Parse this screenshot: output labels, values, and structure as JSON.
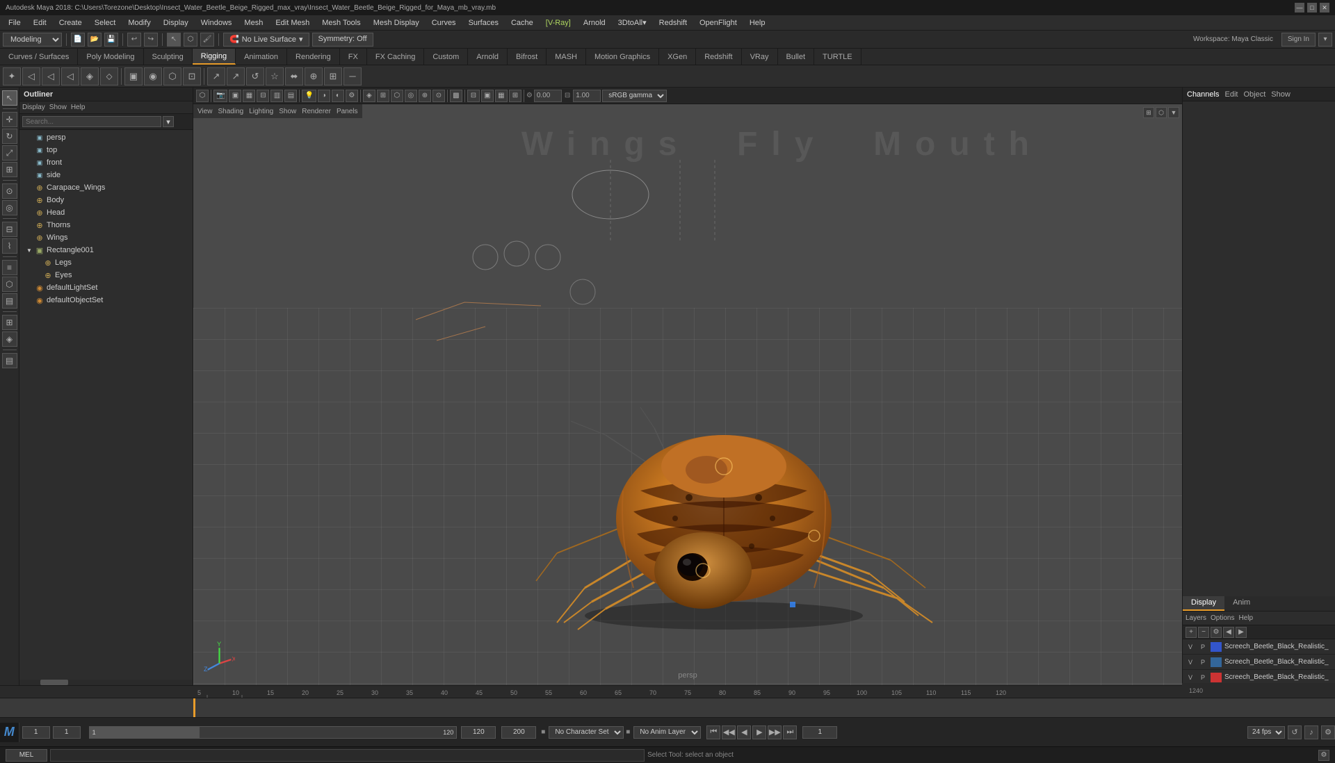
{
  "app": {
    "title": "Autodesk Maya 2018: C:\\Users\\Torezone\\Desktop\\Insect_Water_Beetle_Beige_Rigged_max_vray\\Insect_Water_Beetle_Beige_Rigged_for_Maya_mb_vray.mb",
    "logo": "M"
  },
  "titlebar": {
    "title": "Autodesk Maya 2018: C:\\Users\\Torezone\\Desktop\\Insect_Water_Beetle_Beige_Rigged_max_vray\\Insect_Water_Beetle_Beige_Rigged_for_Maya_mb_vray.mb",
    "controls": [
      "—",
      "□",
      "✕"
    ]
  },
  "menubar": {
    "items": [
      "File",
      "Edit",
      "Create",
      "Select",
      "Modify",
      "Display",
      "Windows",
      "Mesh",
      "Edit Mesh",
      "Mesh Tools",
      "Mesh Display",
      "Curves",
      "Surfaces",
      "Cache",
      "V-Ray",
      "Arnold",
      "3DtoAll",
      "Redshift",
      "OpenFlight",
      "Help"
    ]
  },
  "toolbar": {
    "mode": "Modeling",
    "live_surface": "No Live Surface",
    "symmetry": "Symmetry: Off",
    "workspace": "Workspace: Maya Classic",
    "sign_in": "Sign In"
  },
  "tabs": {
    "items": [
      "Curves / Surfaces",
      "Poly Modeling",
      "Sculpting",
      "Rigging",
      "Animation",
      "Rendering",
      "FX",
      "FX Caching",
      "Custom",
      "Arnold",
      "Bifrost",
      "MASH",
      "Motion Graphics",
      "XGen",
      "Redshift",
      "VRay",
      "Bullet",
      "TURTLE"
    ]
  },
  "outliner": {
    "title": "Outliner",
    "menus": [
      "Display",
      "Show",
      "Help"
    ],
    "search_placeholder": "Search...",
    "items": [
      {
        "name": "persp",
        "type": "camera",
        "indent": 0,
        "expanded": false
      },
      {
        "name": "top",
        "type": "camera",
        "indent": 0,
        "expanded": false
      },
      {
        "name": "front",
        "type": "camera",
        "indent": 0,
        "expanded": false
      },
      {
        "name": "side",
        "type": "camera",
        "indent": 0,
        "expanded": false
      },
      {
        "name": "Carapace_Wings",
        "type": "joint",
        "indent": 0,
        "expanded": false
      },
      {
        "name": "Body",
        "type": "joint",
        "indent": 0,
        "expanded": false
      },
      {
        "name": "Head",
        "type": "joint",
        "indent": 0,
        "expanded": false
      },
      {
        "name": "Thorns",
        "type": "joint",
        "indent": 0,
        "expanded": false
      },
      {
        "name": "Wings",
        "type": "joint",
        "indent": 0,
        "expanded": false
      },
      {
        "name": "Rectangle001",
        "type": "group",
        "indent": 0,
        "expanded": true
      },
      {
        "name": "Legs",
        "type": "joint",
        "indent": 1,
        "expanded": false
      },
      {
        "name": "Eyes",
        "type": "joint",
        "indent": 1,
        "expanded": false
      },
      {
        "name": "defaultLightSet",
        "type": "set",
        "indent": 0,
        "expanded": false
      },
      {
        "name": "defaultObjectSet",
        "type": "set",
        "indent": 0,
        "expanded": false
      }
    ]
  },
  "viewport": {
    "label": "persp",
    "watermark": "Wings  Fly  Mouth",
    "gamma": "sRGB gamma",
    "gamma_value": "0.00",
    "gamma_value2": "1.00"
  },
  "right_panel": {
    "headers": [
      "Channels",
      "Edit",
      "Object",
      "Show"
    ],
    "tabs": [
      "Display",
      "Anim"
    ],
    "subtabs": [
      "Layers",
      "Options",
      "Help"
    ],
    "layers": [
      {
        "v": "V",
        "p": "P",
        "color": "#3355cc",
        "name": "Screech_Beetle_Black_Realistic_"
      },
      {
        "v": "V",
        "p": "P",
        "color": "#336699",
        "name": "Screech_Beetle_Black_Realistic_"
      },
      {
        "v": "V",
        "p": "P",
        "color": "#cc3333",
        "name": "Screech_Beetle_Black_Realistic_"
      }
    ]
  },
  "timeline": {
    "start_frame": "1",
    "current_frame": "1",
    "end_frame": "120",
    "range_start": "1",
    "range_end": "120",
    "total_frames": "200",
    "fps": "24 fps"
  },
  "playback": {
    "buttons": [
      "⏮",
      "⏮",
      "◀",
      "▶",
      "▶",
      "⏭",
      "⏭"
    ],
    "no_character": "No Character Set",
    "no_anim_layer": "No Anim Layer"
  },
  "statusbar": {
    "mode": "MEL",
    "message": "Select Tool: select an object"
  },
  "colors": {
    "accent": "#e89c2a",
    "bg_dark": "#1a1a1a",
    "bg_mid": "#2d2d2d",
    "bg_light": "#3c3c3c",
    "border": "#1a1a1a",
    "text": "#cccccc",
    "blue_layer": "#3355cc",
    "blue2_layer": "#336699",
    "red_layer": "#cc3333"
  }
}
